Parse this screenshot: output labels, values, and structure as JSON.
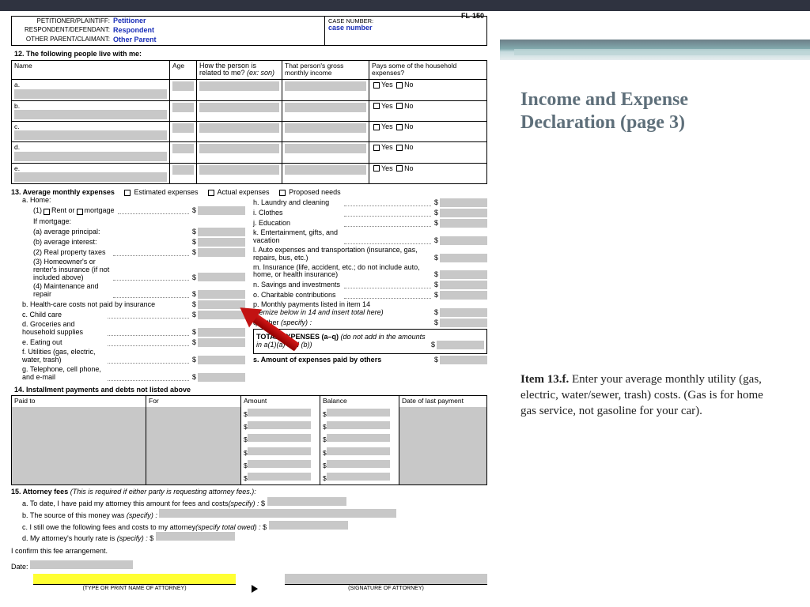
{
  "formCode": "FL-150",
  "header": {
    "petLbl": "PETITIONER/PLAINTIFF:",
    "petVal": "Petitioner",
    "resLbl": "RESPONDENT/DEFENDANT:",
    "resVal": "Respondent",
    "othLbl": "OTHER PARENT/CLAIMANT:",
    "othVal": "Other Parent",
    "caseLbl": "CASE NUMBER:",
    "caseVal": "case number"
  },
  "s12": {
    "title": "12.  The following people live with me:",
    "hName": "Name",
    "hAge": "Age",
    "hRel": "How the person is related to me? ",
    "hRelEx": "(ex: son)",
    "hInc": "That person's gross monthly income",
    "hPay": "Pays some of the household expenses?",
    "rows": [
      "a.",
      "b.",
      "c.",
      "d.",
      "e."
    ],
    "yes": "Yes",
    "no": "No"
  },
  "s13": {
    "title": "13.  Average monthly expenses",
    "est": "Estimated expenses",
    "act": "Actual expenses",
    "prop": "Proposed needs",
    "aHome": "a. Home:",
    "rentOr": "(1)",
    "rent": "Rent or",
    "mort": "mortgage",
    "ifmort": "If mortgage:",
    "ap": "(a)   average principal:",
    "ai": "(b)   average interest:",
    "rpt": "(2) Real property taxes",
    "ins": "(3) Homeowner's or renter's insurance (if not included above)",
    "mr": "(4) Maintenance and repair",
    "hc": "b. Health-care costs not paid by insurance",
    "cc": "c. Child care",
    "gr": "d. Groceries and household supplies",
    "eo": "e. Eating out",
    "ut": "f. Utilities (gas, electric, water, trash)",
    "tel": "g. Telephone, cell phone, and e-mail",
    "h": "h. Laundry and cleaning",
    "i": "i.  Clothes",
    "j": "j.  Education",
    "k": "k. Entertainment, gifts, and vacation",
    "l": "l.  Auto expenses and transportation (insurance, gas, repairs, bus, etc.)",
    "m": "m. Insurance (life, accident, etc.; do not include auto, home, or health insurance)",
    "n": "n. Savings and investments",
    "o": "o. Charitable contributions",
    "p": "p. Monthly payments listed in item 14",
    "pit": "(itemize below in 14 and insert total here)",
    "q": "q. Other ",
    "qsp": "(specify) :",
    "tot": "TOTAL EXPENSES (a–q) ",
    "totit": "(do not add in the amounts in a(1)(a) and (b))",
    "s": "s.  Amount of expenses paid by others"
  },
  "s14": {
    "title": "14.  Installment payments and debts not listed above",
    "h1": "Paid to",
    "h2": "For",
    "h3": "Amount",
    "h4": "Balance",
    "h5": "Date of last payment"
  },
  "s15": {
    "title": "15.  Attorney fees ",
    "titit": "(This is required if either party is requesting attorney fees.):",
    "a": "a.   To date, I have paid my attorney this amount for fees and costs",
    "sp": "(specify) :",
    "b": "b.   The source of this money was ",
    "c": "c.   I still owe the following fees and costs to my attorney",
    "cend": "(specify total owed) :",
    "d": "d.   My attorney's hourly rate is ",
    "conf": "I confirm this fee arrangement.",
    "date": "Date:",
    "sigA": "(TYPE OR PRINT NAME OF ATTORNEY)",
    "sigB": "(SIGNATURE OF ATTORNEY)"
  },
  "side": {
    "title": "Income and Expense Declaration (page 3)",
    "b": "Item 13.f.",
    "body": "  Enter your average monthly utility (gas, electric, water/sewer, trash) costs.  (Gas is for home gas service, not gasoline for your car)."
  }
}
